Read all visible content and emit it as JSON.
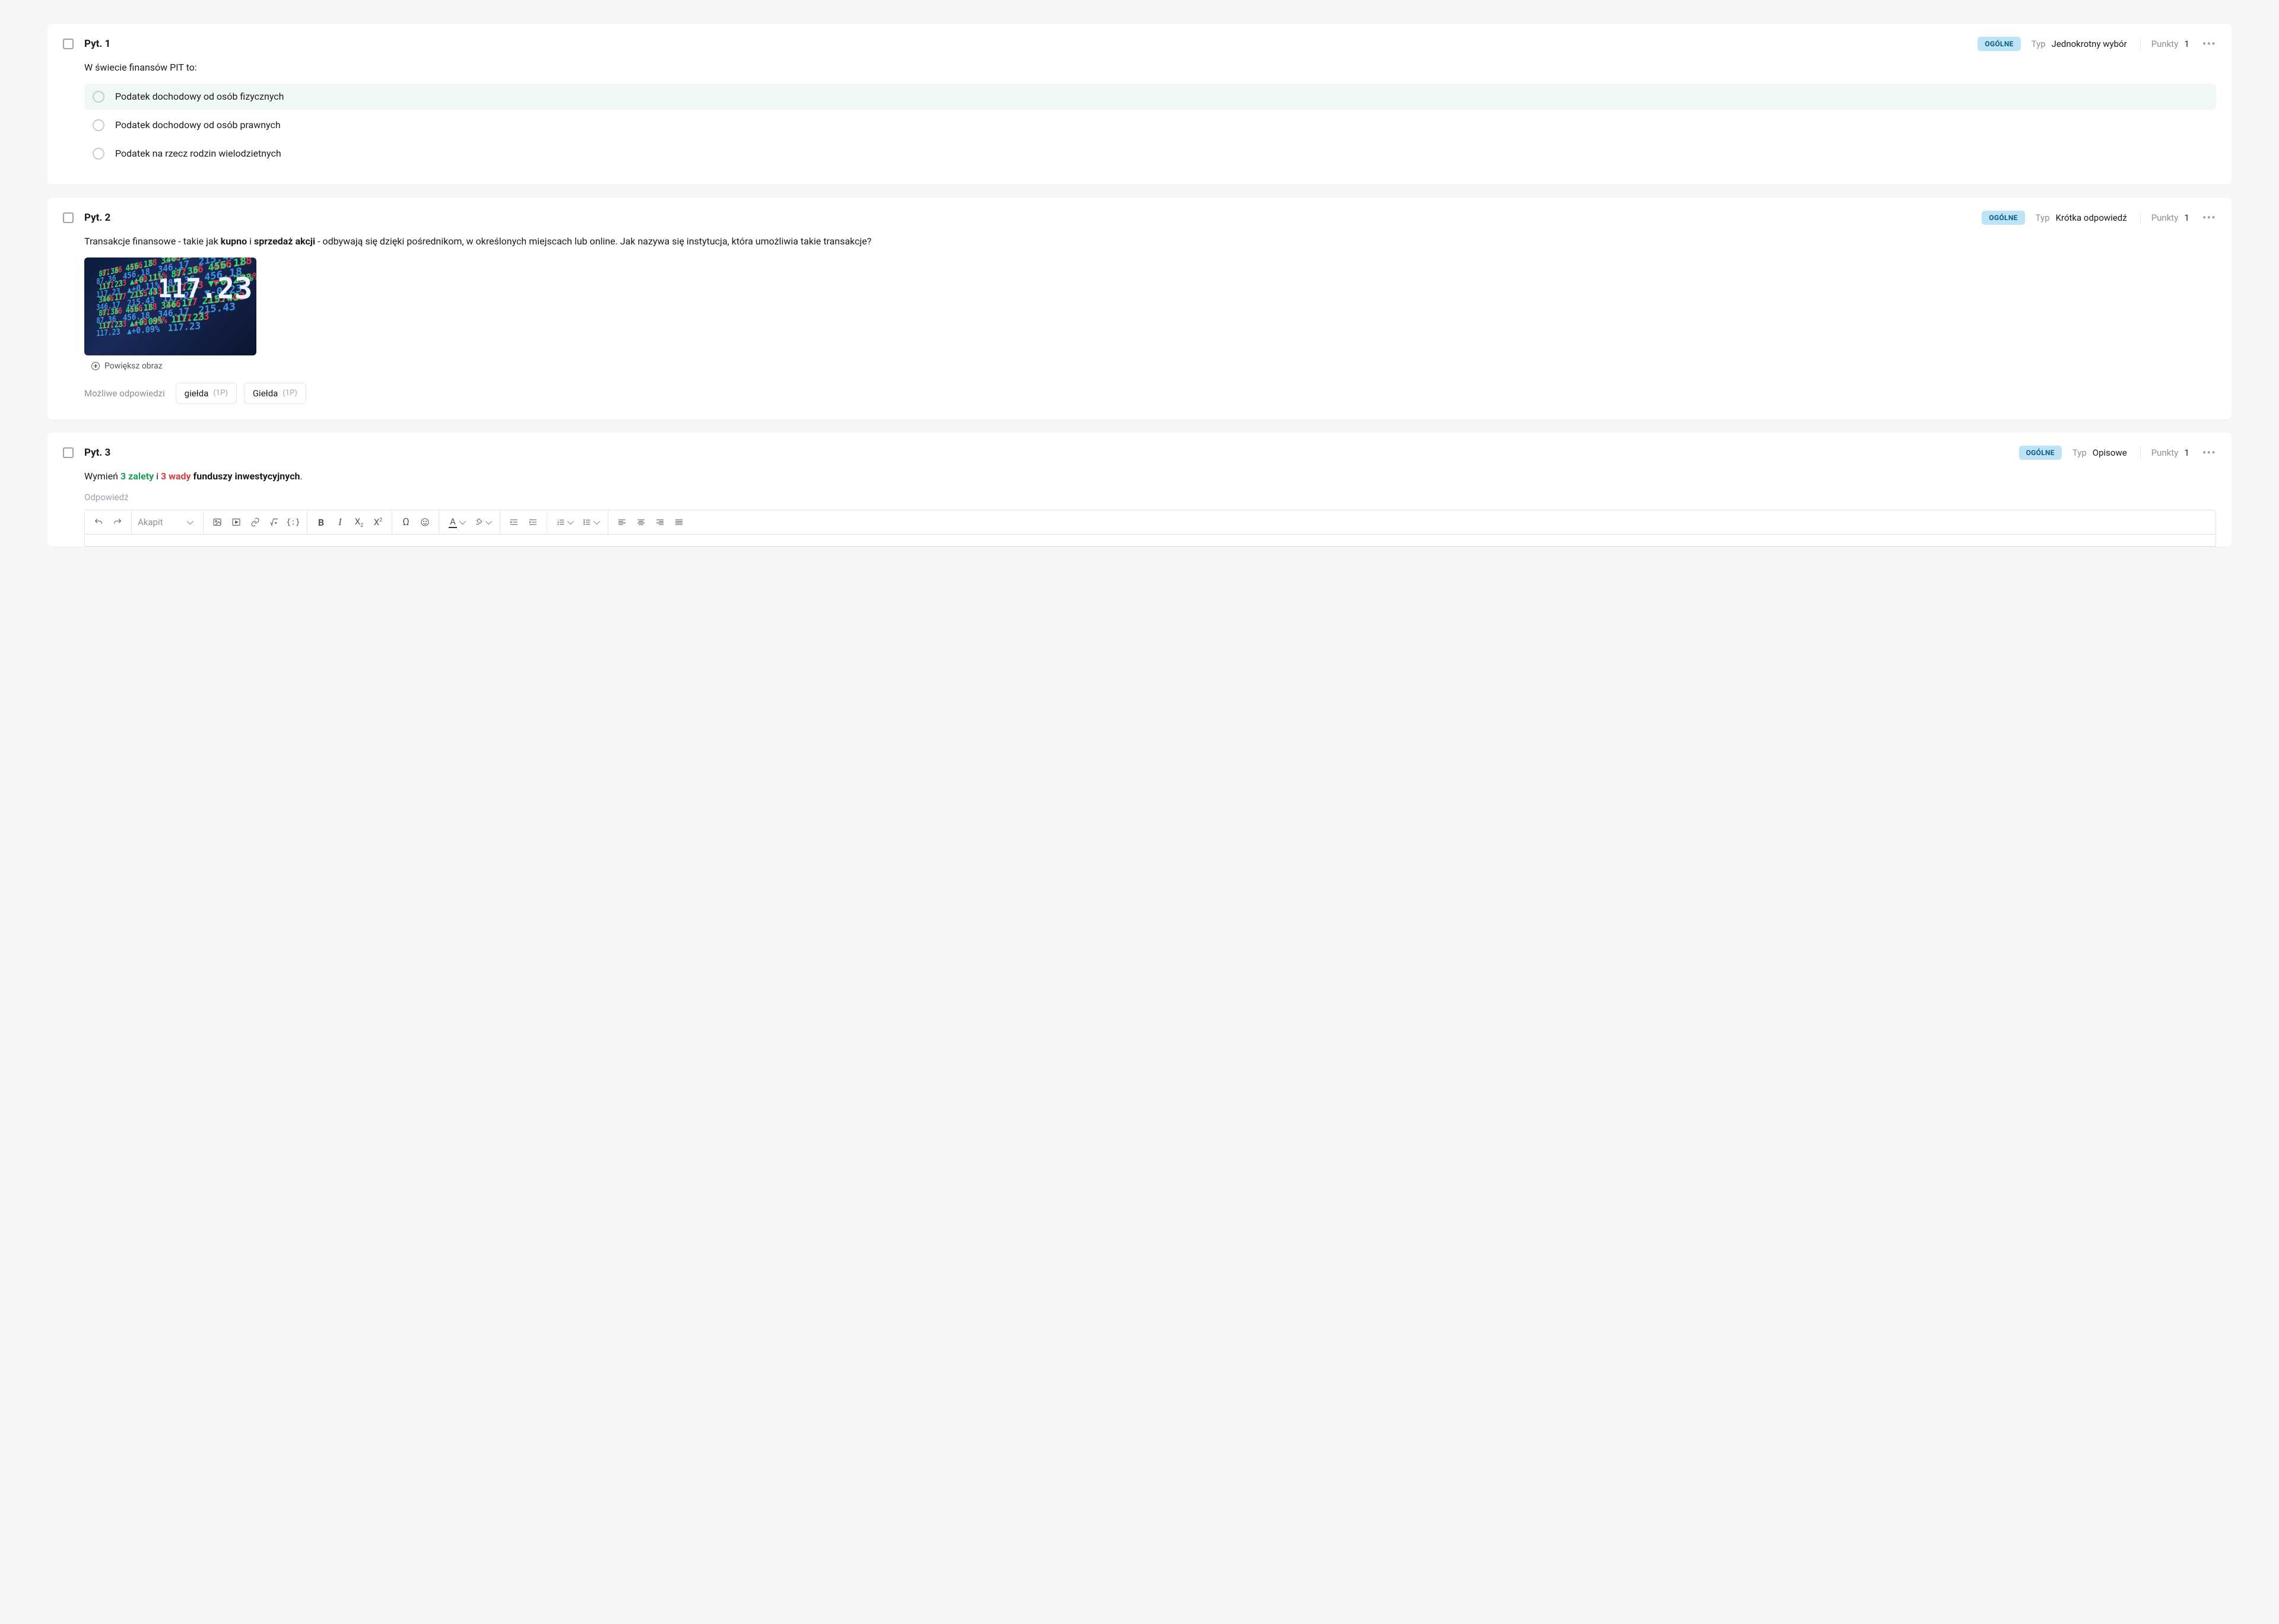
{
  "q1": {
    "number": "Pyt. 1",
    "badge": "OGÓLNE",
    "type_label": "Typ",
    "type_value": "Jednokrotny wybór",
    "points_label": "Punkty",
    "points_value": "1",
    "text": "W świecie finansów PIT to:",
    "options": [
      "Podatek dochodowy od osób fizycznych",
      "Podatek dochodowy od osób prawnych",
      "Podatek na rzecz rodzin wielodzietnych"
    ]
  },
  "q2": {
    "number": "Pyt. 2",
    "badge": "OGÓLNE",
    "type_label": "Typ",
    "type_value": "Krótka odpowiedź",
    "points_label": "Punkty",
    "points_value": "1",
    "text_pre": "Transakcje finansowe - takie jak ",
    "text_b1": "kupno",
    "text_mid": " i ",
    "text_b2": "sprzedaż akcji",
    "text_post": " - odbywają się dzięki pośrednikom, w określonych miejscach lub online. Jak nazywa się instytucja, która umożliwia takie transakcje?",
    "image_big_number": "117.23",
    "enlarge_label": "Powiększ obraz",
    "answers_label": "Możliwe odpowiedzi",
    "answers": [
      {
        "text": "giełda",
        "pts": "(1P)"
      },
      {
        "text": "Giełda",
        "pts": "(1P)"
      }
    ]
  },
  "q3": {
    "number": "Pyt. 3",
    "badge": "OGÓLNE",
    "type_label": "Typ",
    "type_value": "Opisowe",
    "points_label": "Punkty",
    "points_value": "1",
    "text_pre": "Wymień ",
    "text_green": "3 zalety",
    "text_mid": " i ",
    "text_red": "3 wady",
    "text_post": " funduszy inwestycyjnych",
    "text_period": ".",
    "answer_label": "Odpowiedź",
    "toolbar": {
      "format": "Akapit"
    }
  }
}
